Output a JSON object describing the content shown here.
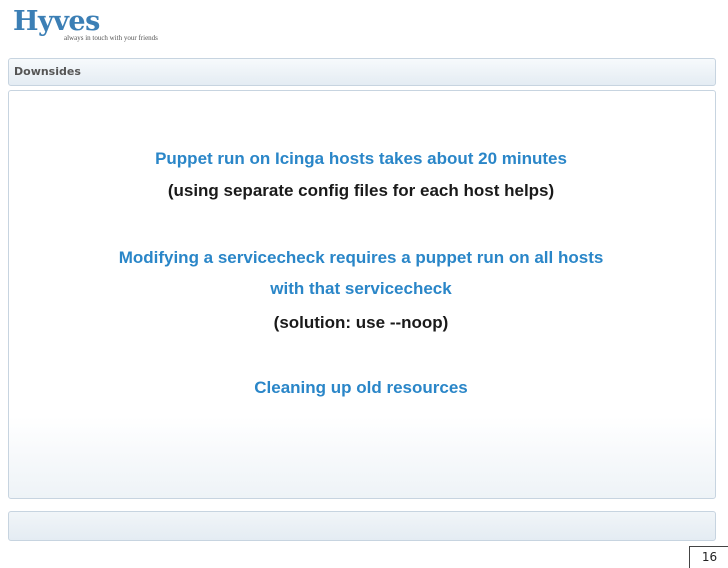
{
  "header": {
    "logo_text": "Hyves",
    "tagline": "always in touch with your friends"
  },
  "section": {
    "title": "Downsides"
  },
  "slide": {
    "lines": [
      "Puppet run on Icinga hosts takes about 20 minutes",
      "(using separate config files for each host helps)",
      "Modifying a servicecheck requires a puppet run on all hosts",
      "with that servicecheck",
      "(solution: use --noop)",
      "Cleaning up old resources"
    ]
  },
  "footer": {
    "page_number": "16"
  },
  "colors": {
    "accent_blue": "#2a86c8",
    "logo_blue": "#3c7fb5",
    "text_dark": "#1a1a1a"
  }
}
